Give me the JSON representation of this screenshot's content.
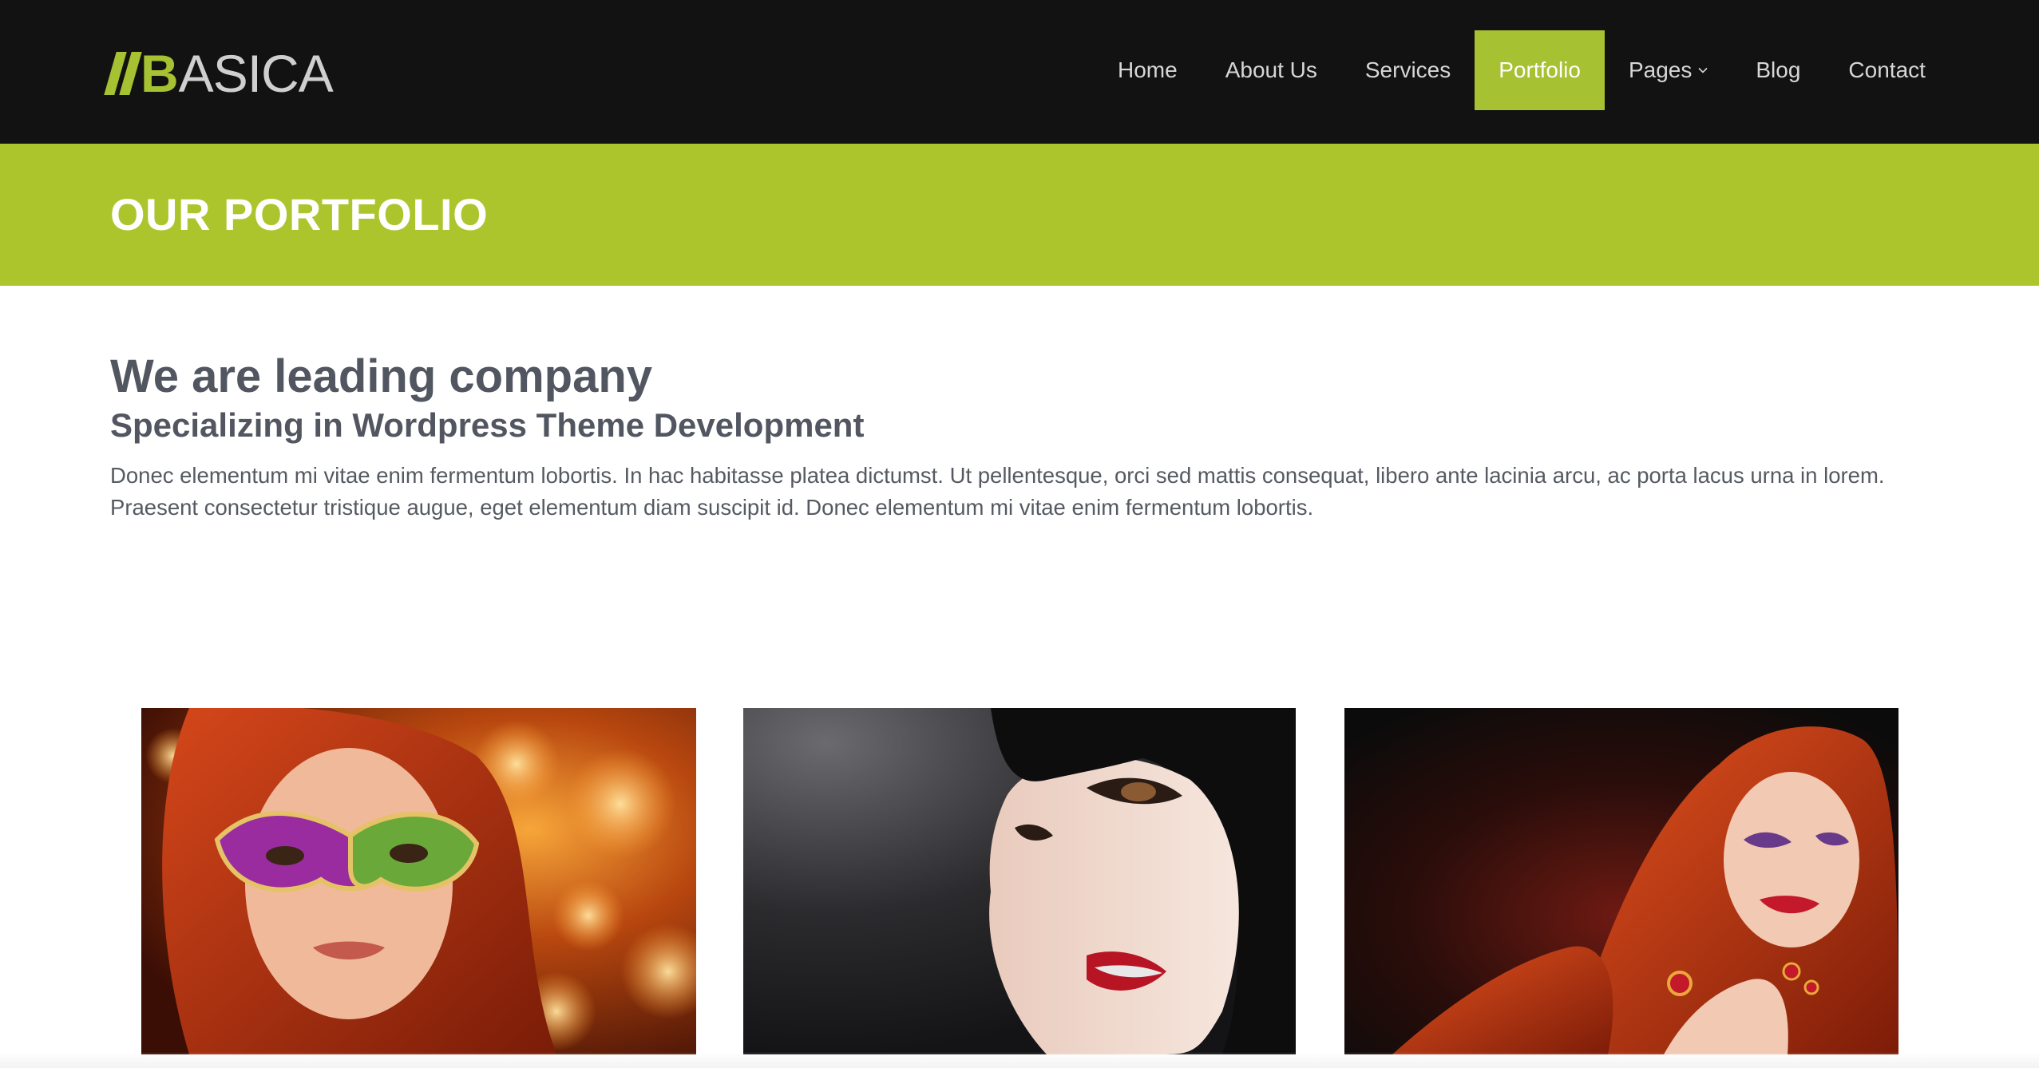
{
  "brand": {
    "logo_initial": "B",
    "logo_rest": "ASICA",
    "accent_color": "#a6c131",
    "header_bg": "#121212"
  },
  "nav": {
    "items": [
      {
        "label": "Home",
        "active": false
      },
      {
        "label": "About Us",
        "active": false
      },
      {
        "label": "Services",
        "active": false
      },
      {
        "label": "Portfolio",
        "active": true
      },
      {
        "label": "Pages",
        "active": false,
        "has_dropdown": true,
        "icon": "chevron-down-icon"
      },
      {
        "label": "Blog",
        "active": false
      },
      {
        "label": "Contact",
        "active": false
      }
    ]
  },
  "page": {
    "title": "OUR PORTFOLIO",
    "title_band_color": "#acc52d"
  },
  "intro": {
    "heading": "We are leading company",
    "subheading": "Specializing in Wordpress Theme Development",
    "paragraph_line1": "Donec elementum mi vitae enim fermentum lobortis. In hac habitasse platea dictumst. Ut pellentesque, orci sed mattis consequat, libero ante lacinia arcu, ac porta lacus urna in lorem.",
    "paragraph_line2": "Praesent consectetur tristique augue, eget elementum diam suscipit id. Donec elementum mi vitae enim fermentum lobortis."
  },
  "portfolio": {
    "items": [
      {
        "icon": "photo-icon"
      },
      {
        "icon": "photo-icon"
      },
      {
        "icon": "photo-icon"
      }
    ]
  }
}
